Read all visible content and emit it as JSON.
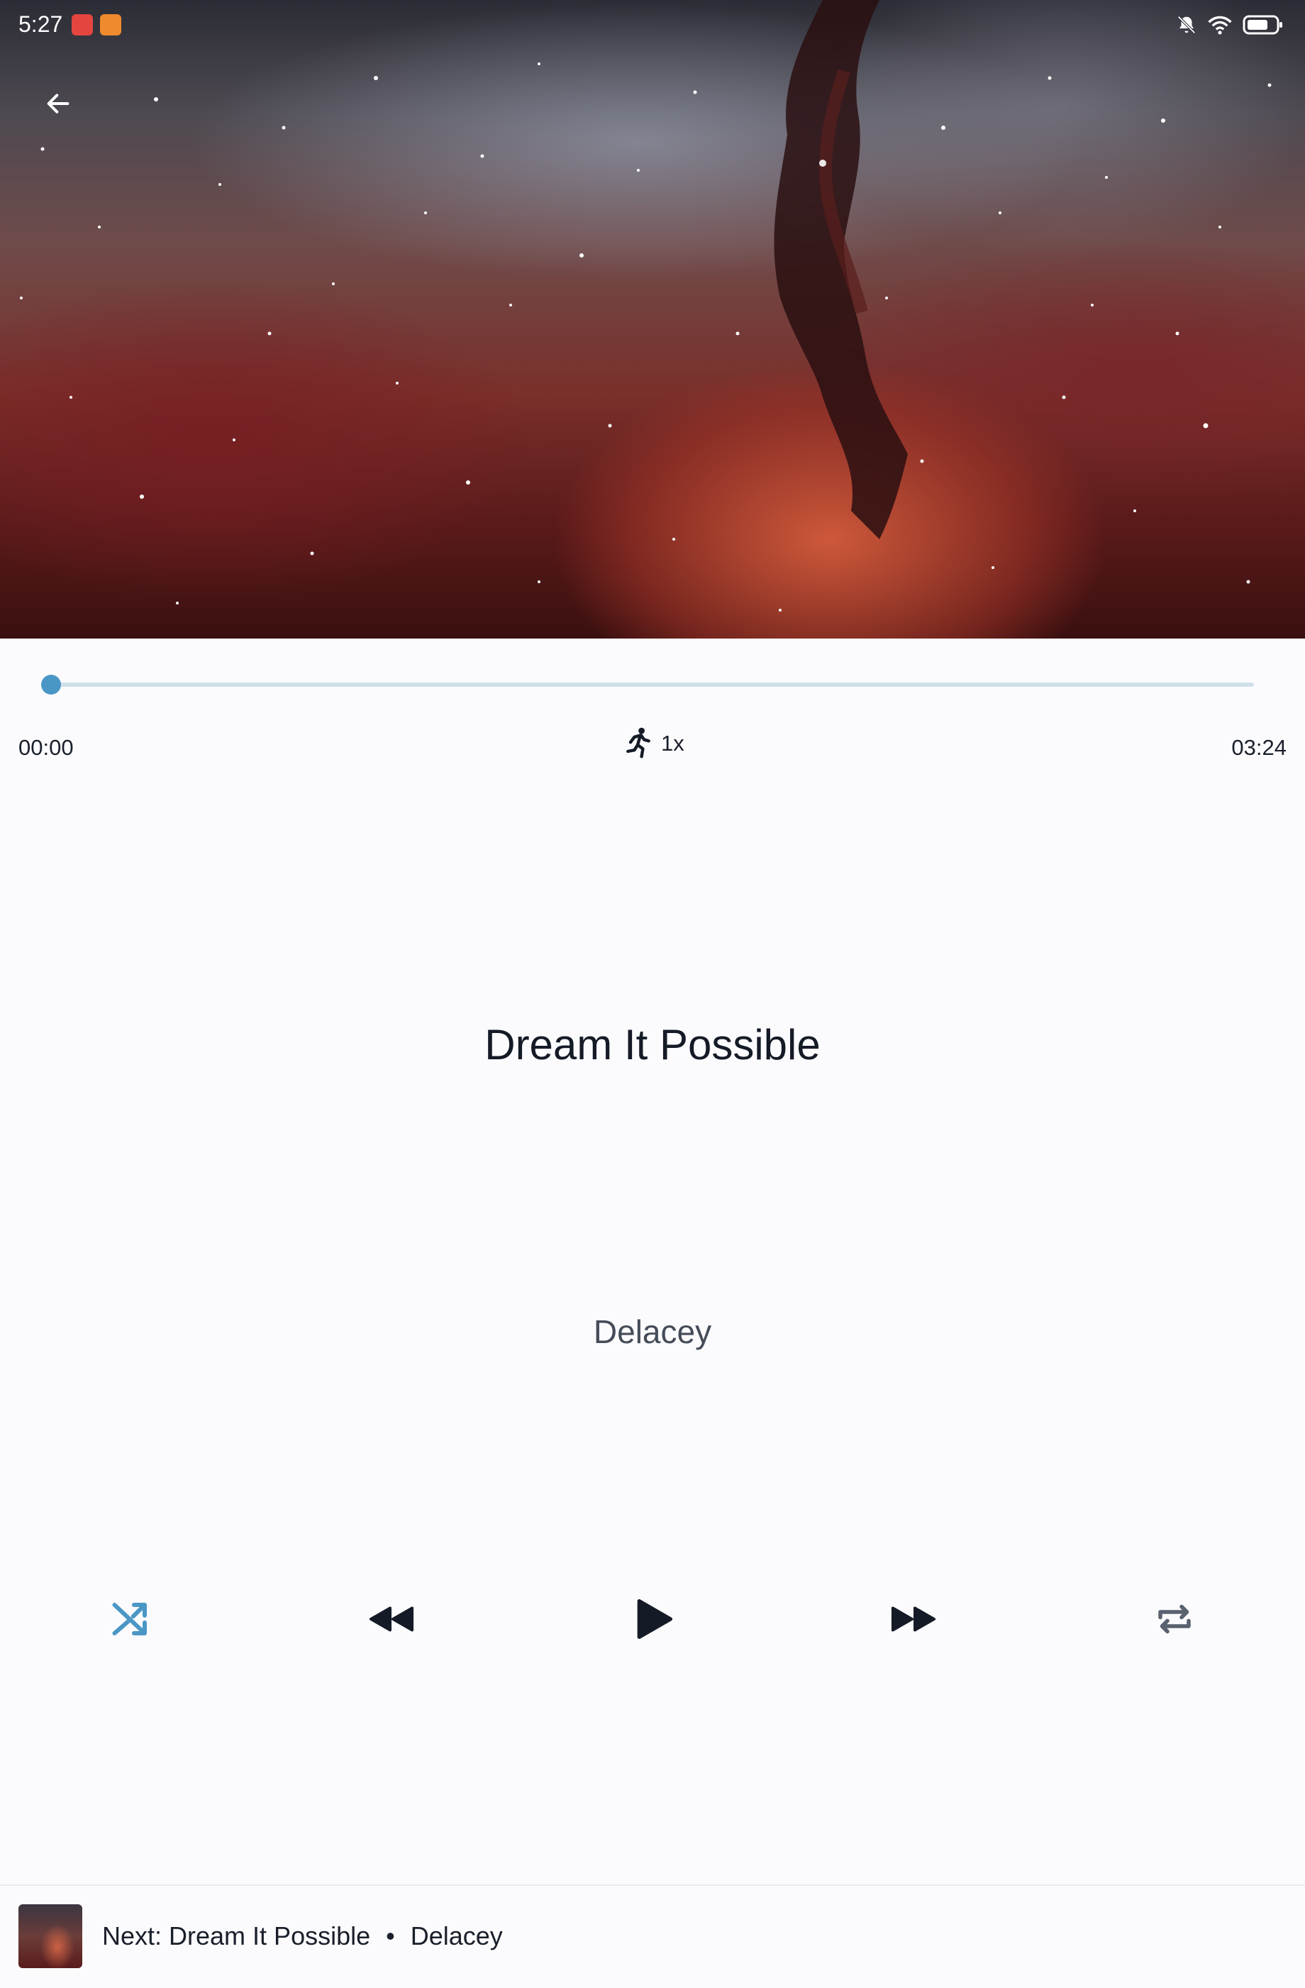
{
  "status_bar": {
    "time": "5:27",
    "icons": [
      "mute-bell-icon",
      "wifi-icon",
      "battery-icon"
    ]
  },
  "header": {
    "back_icon": "arrow-left-icon"
  },
  "player": {
    "progress": 0.0,
    "current_time": "00:00",
    "total_time": "03:24",
    "speed_label": "1x",
    "speed_icon": "running-person-icon",
    "accent_color": "#4a97c6"
  },
  "song": {
    "title": "Dream It Possible",
    "artist": "Delacey"
  },
  "controls": {
    "shuffle_icon": "shuffle-icon",
    "previous_icon": "rewind-icon",
    "play_icon": "play-icon",
    "next_icon": "fast-forward-icon",
    "repeat_icon": "repeat-icon"
  },
  "next_up": {
    "prefix": "Next: Dream It Possible",
    "separator": "•",
    "artist": "Delacey"
  }
}
